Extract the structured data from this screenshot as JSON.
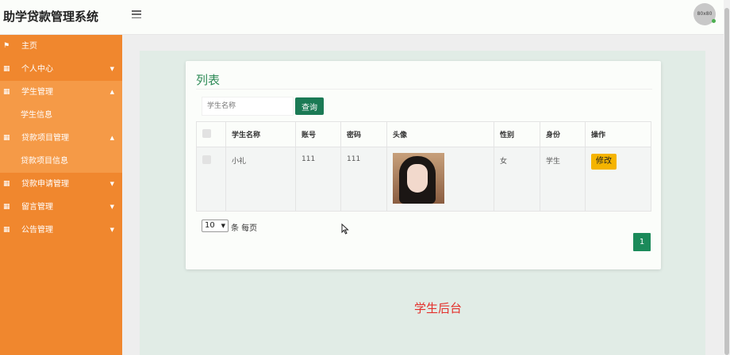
{
  "header": {
    "app_title": "助学贷款管理系统",
    "avatar_text": "80x80"
  },
  "sidebar": {
    "items": [
      {
        "label": "主页",
        "icon": "flag-icon"
      },
      {
        "label": "个人中心",
        "icon": "grid-icon"
      },
      {
        "label": "学生管理",
        "icon": "grid-icon",
        "expanded": true
      },
      {
        "label": "学生信息",
        "sub": true
      },
      {
        "label": "贷款项目管理",
        "icon": "grid-icon",
        "expanded": true
      },
      {
        "label": "贷款项目信息",
        "sub": true
      },
      {
        "label": "贷款申请管理",
        "icon": "grid-icon"
      },
      {
        "label": "留言管理",
        "icon": "grid-icon"
      },
      {
        "label": "公告管理",
        "icon": "grid-icon"
      }
    ]
  },
  "main": {
    "card_title": "列表",
    "search": {
      "placeholder": "学生名称",
      "button_label": "查询"
    },
    "table": {
      "headers": [
        "学生名称",
        "账号",
        "密码",
        "头像",
        "性别",
        "身份",
        "操作"
      ],
      "rows": [
        {
          "name": "小礼",
          "account": "111",
          "password": "111",
          "gender": "女",
          "role": "学生",
          "action": "修改"
        }
      ]
    },
    "pager": {
      "page_size": "10",
      "per_page_label": "条 每页",
      "current_page": "1"
    },
    "footer_title": "学生后台"
  },
  "colors": {
    "sidebar": "#f0872e",
    "sidebar_active": "#f59a47",
    "accent_green": "#1b7a55",
    "edit_button": "#f5b400",
    "footer_text": "#e3302b"
  }
}
